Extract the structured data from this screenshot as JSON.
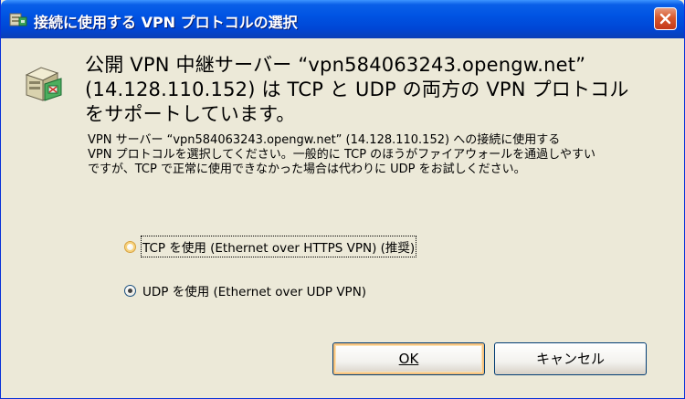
{
  "window": {
    "title": "接続に使用する VPN プロトコルの選択"
  },
  "icons": {
    "title_icon": "network-adapter-icon",
    "server_icon": "vpn-server-icon",
    "close_icon": "close-icon"
  },
  "heading": {
    "line1": "公開 VPN 中継サーバー “vpn584063243.opengw.net”",
    "line2": "(14.128.110.152) は TCP と UDP の両方の VPN プロトコル",
    "line3": "をサポートしています。"
  },
  "description": {
    "line1": "VPN サーバー “vpn584063243.opengw.net” (14.128.110.152) への接続に使用する",
    "line2": "VPN プロトコルを選択してください。一般的に TCP のほうがファイアウォールを通過しやすい",
    "line3": "ですが、TCP で正常に使用できなかった場合は代わりに UDP をお試しください。"
  },
  "options": [
    {
      "label": "TCP を使用 (Ethernet over HTTPS VPN) (推奨)",
      "selected": false
    },
    {
      "label": "UDP を使用 (Ethernet over UDP VPN)",
      "selected": true
    }
  ],
  "buttons": {
    "ok_label": "OK",
    "cancel_label": "キャンセル"
  },
  "colors": {
    "titlebar": "#0054e3",
    "close_button": "#d8582c",
    "dialog_background": "#ece9d8",
    "default_button_highlight": "#f6c27e"
  }
}
